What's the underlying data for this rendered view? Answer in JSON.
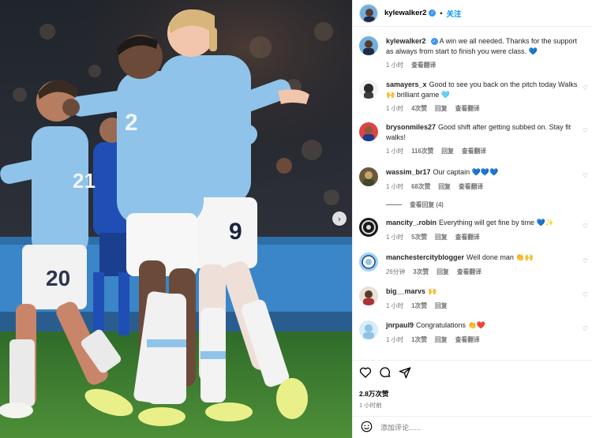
{
  "photo": {
    "next_icon": "chevron-right-icon",
    "jersey_numbers": [
      "2",
      "9",
      "20",
      "21"
    ]
  },
  "header": {
    "username": "kylewalker2",
    "verified": true,
    "separator": "•",
    "follow_label": "关注"
  },
  "caption": {
    "username": "kylewalker2",
    "text": "A win we all needed. Thanks for the support as always from start to finish you were class. 💙",
    "time": "1 小时",
    "translate": "查看翻译"
  },
  "comments": [
    {
      "username": "samayers_x",
      "text": "Good to see you back on the pitch today Walks 🙌 brilliant game 🩵",
      "time": "1 小时",
      "likes": "4次赞",
      "reply": "回复",
      "translate": "查看翻译"
    },
    {
      "username": "brysonmiles27",
      "text": "Good shift after getting subbed on. Stay fit walks!",
      "time": "1 小时",
      "likes": "116次赞",
      "reply": "回复",
      "translate": "查看翻译"
    },
    {
      "username": "wassim_br17",
      "text": "Our captain 💙💙💙",
      "time": "1 小时",
      "likes": "68次赞",
      "reply": "回复",
      "translate": "查看翻译"
    },
    {
      "username": "mancity_.robin",
      "text": "Everything will get fine by time 💙✨",
      "time": "1 小时",
      "likes": "5次赞",
      "reply": "回复",
      "translate": "查看翻译"
    },
    {
      "username": "manchestercityblogger",
      "text": "Well done man 👏🙌",
      "time": "26分钟",
      "likes": "3次赞",
      "reply": "回复",
      "translate": "查看翻译"
    },
    {
      "username": "big__marvs",
      "text": "🙌",
      "time": "1 小时",
      "likes": "1次赞",
      "reply": "回复",
      "translate": ""
    },
    {
      "username": "jnrpaul9",
      "text": "Congratulations 👏❤️",
      "time": "1 小时",
      "likes": "1次赞",
      "reply": "回复",
      "translate": "查看翻译"
    }
  ],
  "view_replies": "查看回复 (4)",
  "actions": {
    "icons": [
      "heart-icon",
      "comment-icon",
      "share-icon"
    ],
    "likes": "2.8万次赞",
    "time": "1 小时前"
  },
  "add_comment": {
    "placeholder": "添加评论......",
    "icon": "emoji-icon"
  },
  "colors": {
    "link_blue": "#0095f6",
    "verified_blue": "#3897f0",
    "sky_blue_kit": "#8fc3e9",
    "meta_gray": "#737373"
  }
}
